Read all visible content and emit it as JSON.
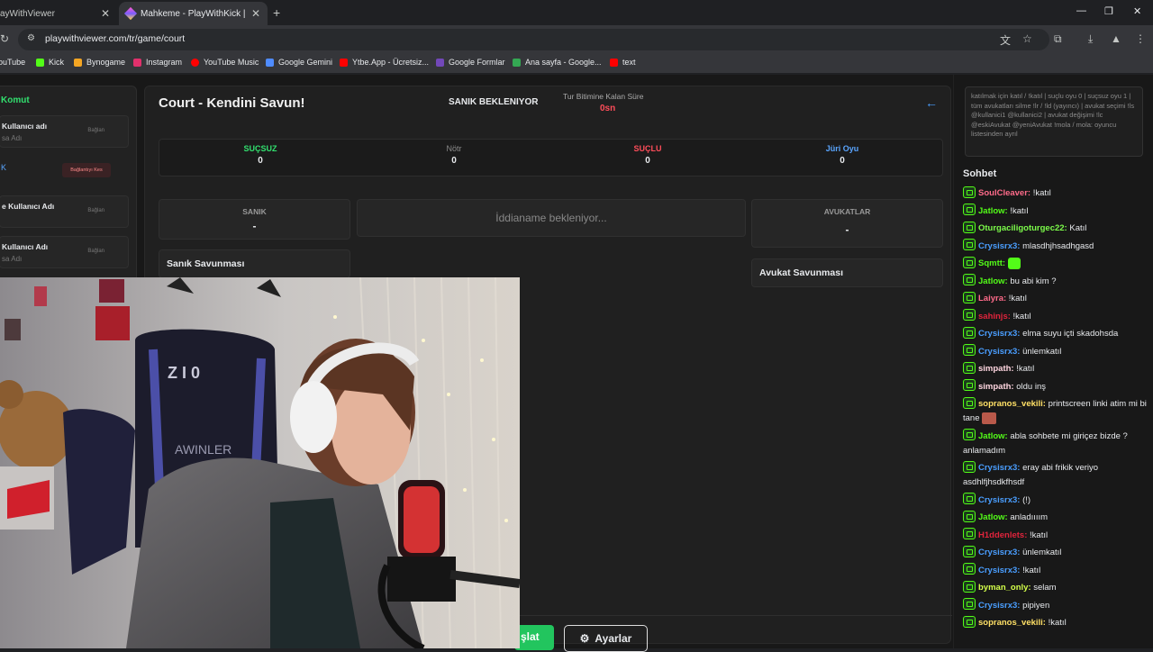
{
  "browser": {
    "tabs": [
      {
        "title": "ayWithViewer",
        "close": "✕"
      },
      {
        "title": "Mahkeme - PlayWithKick | Play",
        "close": "✕"
      }
    ],
    "new_tab": "+",
    "window_controls": [
      "—",
      "❐",
      "✕"
    ],
    "url": "playwithviewer.com/tr/game/court",
    "bookmarks": [
      {
        "label": "ouTube",
        "color": "#ff0000"
      },
      {
        "label": "Kick",
        "color": "#53fc18"
      },
      {
        "label": "Bynogame",
        "color": "#f5a623"
      },
      {
        "label": "Instagram",
        "color": "#e1306c"
      },
      {
        "label": "YouTube Music",
        "color": "#ff0000"
      },
      {
        "label": "Google Gemini",
        "color": "#4f8cff"
      },
      {
        "label": "Ytbe.App - Ücretsiz...",
        "color": "#ff0000"
      },
      {
        "label": "Google Formlar",
        "color": "#7248b9"
      },
      {
        "label": "Ana sayfa - Google...",
        "color": "#34a853"
      },
      {
        "label": "text",
        "color": "#ff0000"
      }
    ]
  },
  "left_panel": {
    "title": "Komut",
    "cards": [
      {
        "name": "Kullanıcı adı",
        "sub": "sa Adı",
        "status": "Bağlan"
      },
      {
        "name": "",
        "sub": "",
        "status": "",
        "link": "K",
        "kick_label": "Bağlantıyı Kes"
      },
      {
        "name": "e Kullanıcı Adı",
        "sub": "",
        "status": "Bağlan"
      },
      {
        "name": "Kullanıcı Adı",
        "sub": "sa Adı",
        "status": "Bağlan"
      }
    ]
  },
  "game": {
    "title": "Court - Kendini Savun!",
    "state": "SANIK BEKLENIYOR",
    "timer_label": "Tur Bitimine Kalan Süre",
    "timer_value": "0sn",
    "votes": [
      {
        "label": "SUÇSUZ",
        "value": "0",
        "color": "#32e06f"
      },
      {
        "label": "Nötr",
        "value": "0",
        "color": "#8a8a8a"
      },
      {
        "label": "SUÇLU",
        "value": "0",
        "color": "#ff4d5a"
      },
      {
        "label": "Jüri Oyu",
        "value": "0",
        "color": "#5aa5ff"
      }
    ],
    "defendant_label": "SANIK",
    "defendant_value": "-",
    "indictment": "İddianame bekleniyor...",
    "lawyers_label": "AVUKATLAR",
    "lawyers_value": "-",
    "defendant_defense": "Sanık Savunması",
    "lawyer_defense": "Avukat Savunması",
    "start_button": "şlat",
    "settings_button": "Ayarlar"
  },
  "chat": {
    "commands": "katılmak için katıl / !katıl | suçlu oyu 0 | suçsuz oyu 1 | tüm avukatları silme !lr / !ld (yayıncı) | avukat seçimi !ls @kullanici1 @kullanici2 | avukat değişimi !lc @eskiAvukat @yeniAvukat !mola / mola: oyuncu listesinden ayrıl",
    "title": "Sohbet",
    "messages": [
      {
        "user": "SoulCleaver:",
        "text": "!katıl",
        "color": "#ff6b8a"
      },
      {
        "user": "Jatlow:",
        "text": "!katıl",
        "color": "#53fc18"
      },
      {
        "user": "Oturgaciligoturgec22:",
        "text": "Katıl",
        "color": "#7cfc4a"
      },
      {
        "user": "Crysisrx3:",
        "text": "mlasdhjhsadhgasd",
        "color": "#4a9eff"
      },
      {
        "user": "Sqmtt:",
        "text": "",
        "color": "#53fc18",
        "emote": "green"
      },
      {
        "user": "Jatlow:",
        "text": "bu abi kim ?",
        "color": "#53fc18"
      },
      {
        "user": "Laiyra:",
        "text": "!katıl",
        "color": "#ff6b8a"
      },
      {
        "user": "sahinjs:",
        "text": "!katıl",
        "color": "#e0243c"
      },
      {
        "user": "Crysisrx3:",
        "text": "elma suyu içti skadohsda",
        "color": "#4a9eff"
      },
      {
        "user": "Crysisrx3:",
        "text": "ünlemkatıl",
        "color": "#4a9eff"
      },
      {
        "user": "simpath:",
        "text": "!katıl",
        "color": "#ffd6e0"
      },
      {
        "user": "simpath:",
        "text": "oldu inş",
        "color": "#ffd6e0"
      },
      {
        "user": "sopranos_vekili:",
        "text": "printscreen linki atim mi bi tane",
        "color": "#ffe066",
        "emote": "image"
      },
      {
        "user": "Jatlow:",
        "text": "abla sohbete mi giriçez bizde ? anlamadım",
        "color": "#53fc18"
      },
      {
        "user": "Crysisrx3:",
        "text": "eray abi frikik veriyo asdhlfjhsdkfhsdf",
        "color": "#4a9eff"
      },
      {
        "user": "Crysisrx3:",
        "text": "(!)",
        "color": "#4a9eff"
      },
      {
        "user": "Jatlow:",
        "text": "anladıııım",
        "color": "#53fc18"
      },
      {
        "user": "H1ddenlets:",
        "text": "!katıl",
        "color": "#e0243c"
      },
      {
        "user": "Crysisrx3:",
        "text": "ünlemkatıl",
        "color": "#4a9eff"
      },
      {
        "user": "Crysisrx3:",
        "text": "!katıl",
        "color": "#4a9eff"
      },
      {
        "user": "byman_only:",
        "text": "selam",
        "color": "#d4ff4a"
      },
      {
        "user": "Crysisrx3:",
        "text": "pipiyen",
        "color": "#4a9eff"
      },
      {
        "user": "sopranos_vekili:",
        "text": "!katıl",
        "color": "#ffe066"
      }
    ]
  }
}
